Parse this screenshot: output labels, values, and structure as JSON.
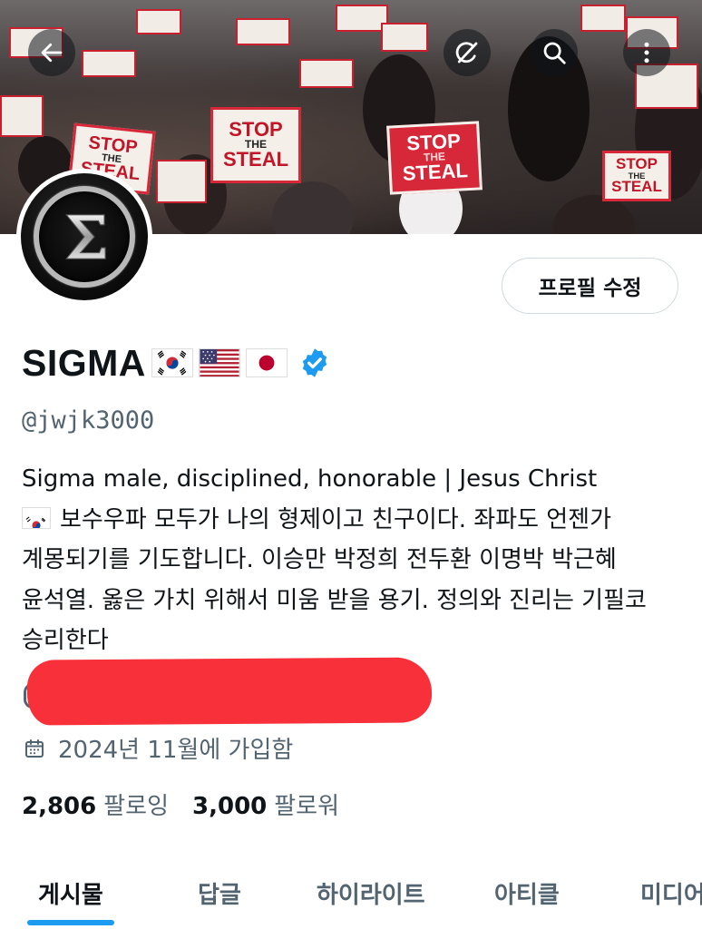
{
  "header": {
    "back_icon": "arrow-left-icon",
    "grok_icon": "grok-slash-circle-icon",
    "search_icon": "search-icon",
    "more_icon": "more-vertical-icon",
    "banner_signs": {
      "line1": "STOP",
      "line2": "THE",
      "line3": "STEAL"
    }
  },
  "profile": {
    "edit_button_label": "프로필 수정",
    "display_name": "SIGMA",
    "flags": [
      "south-korea-flag",
      "usa-flag",
      "japan-flag"
    ],
    "verified_icon": "verified-badge-icon",
    "handle": "@jwjk3000",
    "bio_lines": [
      "Sigma male, disciplined, honorable | Jesus Christ",
      "보수우파 모두가 나의 형제이고 친구이다. 좌파도 언젠가",
      "계몽되기를 기도합니다. 이승만 박정희 전두환 이명박 박근혜",
      "윤석열. 옳은 가치 위해서 미움 받을 용기. 정의와 진리는 기필코",
      "승리한다"
    ],
    "joined_text": "2024년 11월에 가입함",
    "following_count": "2,806",
    "following_label": "팔로잉",
    "followers_count": "3,000",
    "followers_label": "팔로워"
  },
  "tabs": [
    {
      "label": "게시물",
      "active": true
    },
    {
      "label": "답글",
      "active": false
    },
    {
      "label": "하이라이트",
      "active": false
    },
    {
      "label": "아티클",
      "active": false
    },
    {
      "label": "미디어",
      "active": false
    }
  ],
  "colors": {
    "accent": "#1d9bf0",
    "redaction": "#f8303a",
    "secondary_text": "#536471"
  }
}
